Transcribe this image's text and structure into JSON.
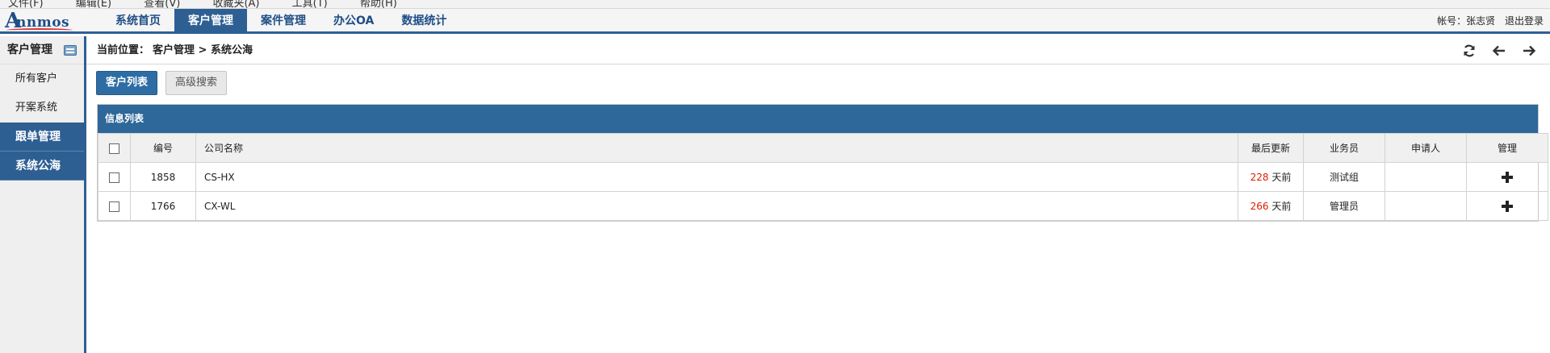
{
  "menubar": [
    "文件(F)",
    "编辑(E)",
    "查看(V)",
    "收藏夹(A)",
    "工具(T)",
    "帮助(H)"
  ],
  "logo": {
    "text": "nnmos",
    "initial": "A"
  },
  "nav": {
    "items": [
      "系统首页",
      "客户管理",
      "案件管理",
      "办公OA",
      "数据统计"
    ],
    "active_index": 1
  },
  "user": {
    "account": "帐号：张志贤",
    "logout": "退出登录"
  },
  "sidebar": {
    "title": "客户管理",
    "items": [
      "所有客户",
      "开案系统"
    ],
    "groups": [
      "跟单管理",
      "系统公海"
    ]
  },
  "breadcrumb": {
    "prefix": "当前位置：",
    "path": "客户管理 > 系统公海"
  },
  "buttons": {
    "list": "客户列表",
    "search": "高级搜索"
  },
  "panel": {
    "title": "信息列表"
  },
  "table": {
    "headers": [
      "",
      "编号",
      "公司名称",
      "最后更新",
      "业务员",
      "申请人",
      "管理"
    ],
    "rows": [
      {
        "id": "1858",
        "company": "CS-HX",
        "days": "228",
        "days_unit": " 天前",
        "agent": "测试组",
        "applicant": ""
      },
      {
        "id": "1766",
        "company": "CX-WL",
        "days": "266",
        "days_unit": " 天前",
        "agent": "管理员",
        "applicant": ""
      }
    ]
  },
  "colors": {
    "primary": "#2e5f93",
    "accent_red": "#d81e06"
  },
  "icons": [
    "refresh-icon",
    "arrow-left-icon",
    "arrow-right-icon",
    "plus-icon",
    "sidebar-toggle-icon"
  ]
}
